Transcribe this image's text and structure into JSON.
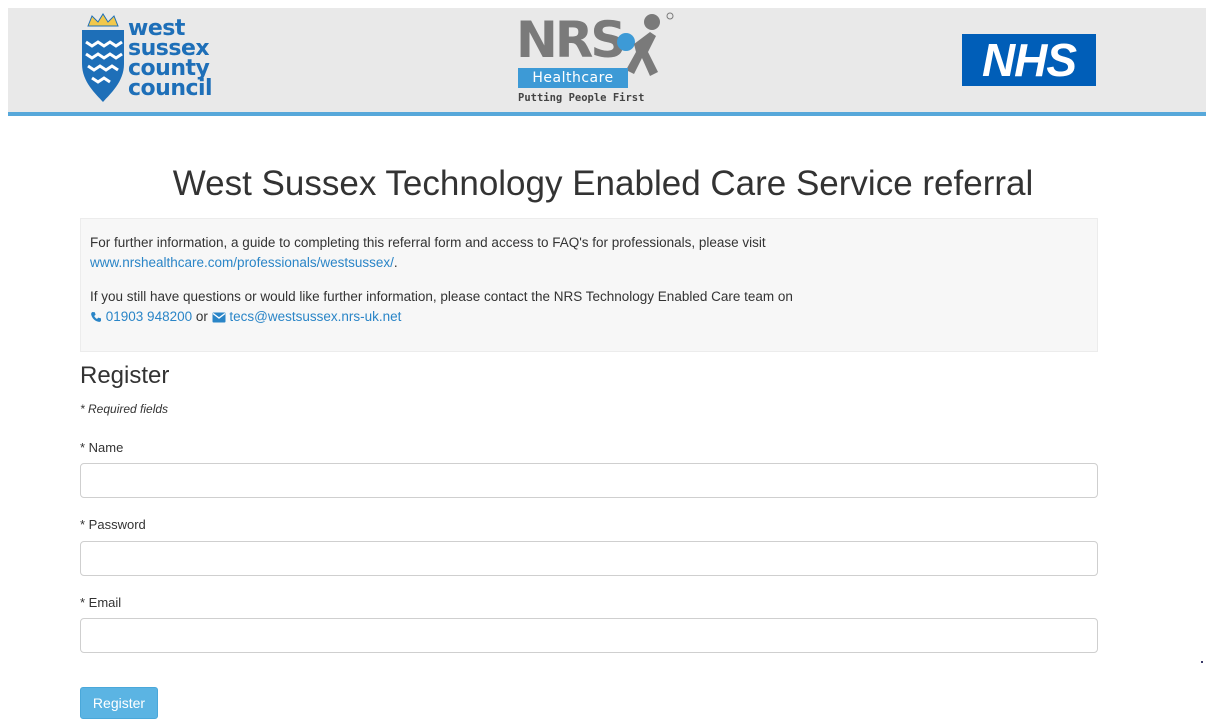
{
  "header": {
    "wscc_logo": {
      "lines": [
        "west",
        "sussex",
        "county",
        "council"
      ],
      "icon": "wscc-shield-icon",
      "color": "#1e6fb8"
    },
    "nrs_logo": {
      "wordmark": "NRS",
      "badge": "Healthcare",
      "tagline": "Putting People First",
      "registered": "®",
      "icon": "nrs-figure-icon"
    },
    "nhs_logo": {
      "text": "NHS",
      "color": "#005eb8"
    },
    "accent_color": "#57a8da"
  },
  "page_title": "West Sussex Technology Enabled Care Service referral",
  "info": {
    "para1_text": "For further information, a guide to completing this referral form and access to FAQ's for professionals, please visit",
    "para1_link": "www.nrshealthcare.com/professionals/westsussex/",
    "para1_end": ".",
    "para2_text": "If you still have questions or would like further information, please contact the NRS Technology Enabled Care team on",
    "phone": "01903 948200",
    "or": "or",
    "email": "tecs@westsussex.nrs-uk.net",
    "link_color": "#2a85c7"
  },
  "form": {
    "heading": "Register",
    "required_note": "* Required fields",
    "fields": [
      {
        "label": "* Name",
        "value": ""
      },
      {
        "label": "* Password",
        "value": ""
      },
      {
        "label": "* Email",
        "value": ""
      }
    ],
    "submit_label": "Register",
    "button_color": "#5bb4e3"
  }
}
